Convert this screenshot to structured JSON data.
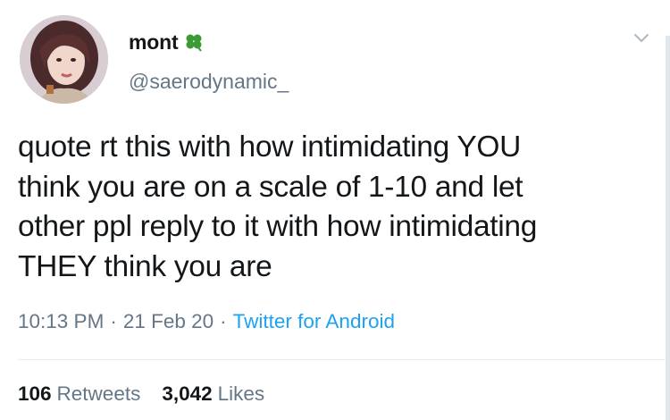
{
  "tweet": {
    "display_name": "mont",
    "name_emoji": "clover-icon",
    "handle": "@saerodynamic_",
    "text_lines": [
      "quote rt this with how intimidating YOU",
      "think you are on a scale of 1-10 and let",
      "other ppl reply to it with how intimidating",
      "THEY think you are"
    ],
    "time": "10:13 PM",
    "date": "21 Feb 20",
    "source": "Twitter for Android",
    "separator": "·",
    "retweets_count": "106",
    "retweets_label": "Retweets",
    "likes_count": "3,042",
    "likes_label": "Likes"
  },
  "colors": {
    "text": "#14171a",
    "secondary": "#657786",
    "link": "#1da1f2",
    "divider": "#e6ecf0",
    "clover": "#3d9b35"
  }
}
